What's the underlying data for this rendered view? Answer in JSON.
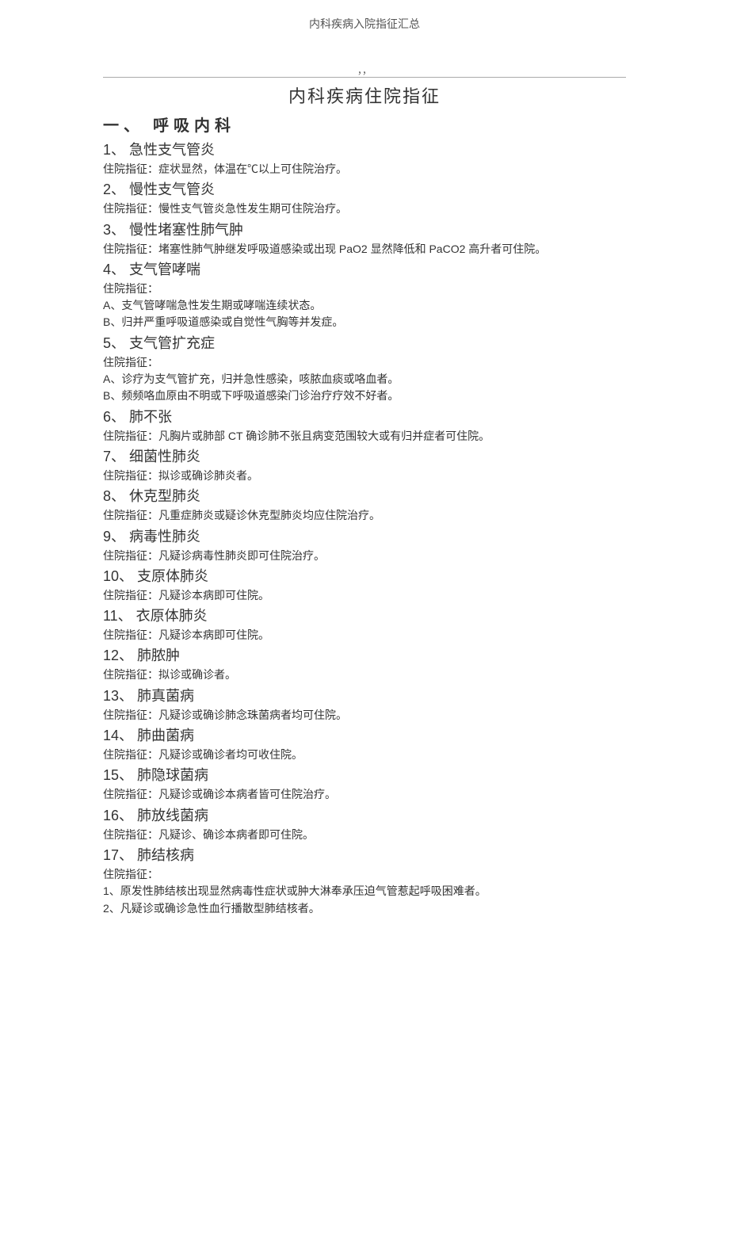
{
  "page_header": "内科疾病入院指征汇总",
  "top_commas": "，，",
  "main_title": "内科疾病住院指征",
  "section_heading": "一、 呼吸内科",
  "items": [
    {
      "title": "1、 急性支气管炎",
      "lines": [
        "住院指征：症状显然，体温在℃以上可住院治疗。"
      ]
    },
    {
      "title": "2、 慢性支气管炎",
      "lines": [
        "住院指征：慢性支气管炎急性发生期可住院治疗。"
      ]
    },
    {
      "title": "3、 慢性堵塞性肺气肿",
      "lines": [
        "住院指征：堵塞性肺气肿继发呼吸道感染或出现 PaO2 显然降低和 PaCO2 高升者可住院。"
      ]
    },
    {
      "title": "4、 支气管哮喘",
      "lines": [
        "住院指征：",
        "A、支气管哮喘急性发生期或哮喘连续状态。",
        "B、归并严重呼吸道感染或自觉性气胸等并发症。"
      ]
    },
    {
      "title": "5、 支气管扩充症",
      "lines": [
        "住院指征：",
        "A、诊疗为支气管扩充，归并急性感染，咳脓血痰或咯血者。",
        "B、频频咯血原由不明或下呼吸道感染门诊治疗疗效不好者。"
      ]
    },
    {
      "title": "6、 肺不张",
      "lines": [
        "住院指征：凡胸片或肺部 CT 确诊肺不张且病变范围较大或有归并症者可住院。"
      ]
    },
    {
      "title": "7、 细菌性肺炎",
      "lines": [
        "住院指征：拟诊或确诊肺炎者。"
      ]
    },
    {
      "title": "8、 休克型肺炎",
      "lines": [
        "住院指征：凡重症肺炎或疑诊休克型肺炎均应住院治疗。"
      ]
    },
    {
      "title": "9、 病毒性肺炎",
      "lines": [
        "住院指征：凡疑诊病毒性肺炎即可住院治疗。"
      ]
    },
    {
      "title": "10、 支原体肺炎",
      "lines": [
        "住院指征：凡疑诊本病即可住院。"
      ]
    },
    {
      "title": "11、 衣原体肺炎",
      "lines": [
        "住院指征：凡疑诊本病即可住院。"
      ]
    },
    {
      "title": "12、 肺脓肿",
      "lines": [
        "住院指征：拟诊或确诊者。"
      ]
    },
    {
      "title": "13、 肺真菌病",
      "lines": [
        "住院指征：凡疑诊或确诊肺念珠菌病者均可住院。"
      ]
    },
    {
      "title": "14、 肺曲菌病",
      "lines": [
        "住院指征：凡疑诊或确诊者均可收住院。"
      ]
    },
    {
      "title": "15、 肺隐球菌病",
      "lines": [
        "住院指征：凡疑诊或确诊本病者皆可住院治疗。"
      ]
    },
    {
      "title": "16、 肺放线菌病",
      "lines": [
        "住院指征：凡疑诊、确诊本病者即可住院。"
      ]
    },
    {
      "title": "17、 肺结核病",
      "lines": [
        "住院指征：",
        "1、原发性肺结核出现显然病毒性症状或肿大淋奉承压迫气管惹起呼吸困难者。",
        "2、凡疑诊或确诊急性血行播散型肺结核者。"
      ]
    }
  ]
}
